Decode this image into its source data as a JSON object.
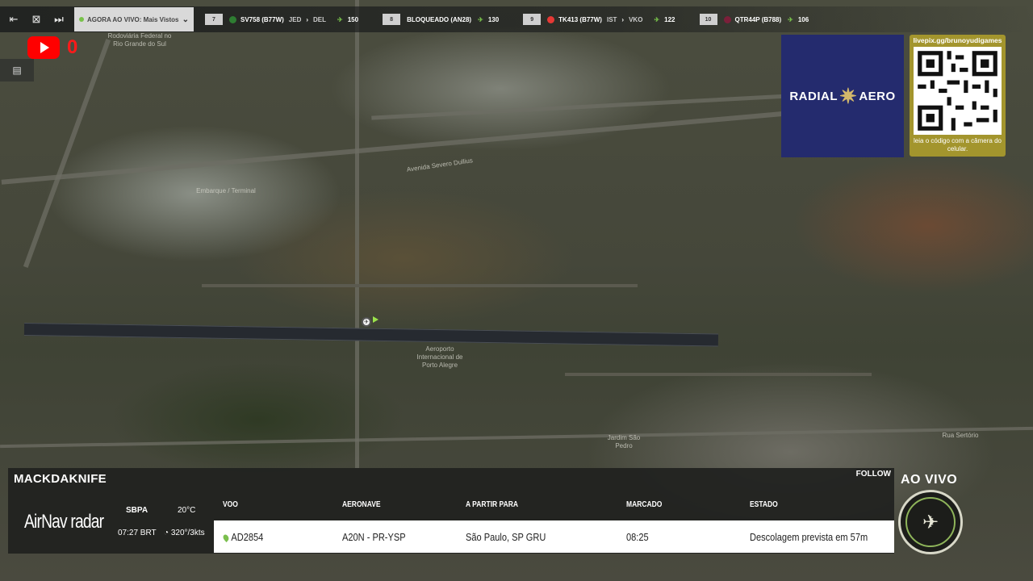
{
  "topbar": {
    "live_label": "AGORA AO VIVO: Mais Vistos",
    "flights": [
      {
        "rank": "7",
        "flag_color": "#2e7d32",
        "callsign": "SV758 (B77W)",
        "from": "JED",
        "to": "DEL",
        "count": "150"
      },
      {
        "rank": "8",
        "flag_color": "",
        "callsign": "BLOQUEADO (AN28)",
        "from": "",
        "to": "",
        "count": "130"
      },
      {
        "rank": "9",
        "flag_color": "#e53935",
        "callsign": "TK413 (B77W)",
        "from": "IST",
        "to": "VKO",
        "count": "122"
      },
      {
        "rank": "10",
        "flag_color": "#7b1f3a",
        "callsign": "QTR44P (B788)",
        "from": "",
        "to": "",
        "count": "106"
      }
    ]
  },
  "youtube": {
    "count": "0"
  },
  "map_labels": {
    "top": "Rodoviária Federal no Rio Grande do Sul",
    "airport": "Aeroporto Internacional de Porto Alegre",
    "terminal": "Embarque / Terminal",
    "avenue1": "Avenida Severo Dullius",
    "avenue2": "Rua Sertório",
    "jardim": "Jardim São Pedro"
  },
  "sponsor": {
    "left_text": "RADIAL",
    "right_text": "AERO",
    "url": "livepix.gg/brunoyudigames",
    "caption": "leia o código com a câmera do celular."
  },
  "panel": {
    "username": "MACKDAKNIFE",
    "follow": "FOLLOW",
    "brand": "AirNav",
    "brand2": "radar",
    "icao": "SBPA",
    "local_time": "07:27 BRT",
    "temp": "20°C",
    "wind": "320°/3kts",
    "headers": {
      "flight": "VOO",
      "aircraft": "AERONAVE",
      "route": "A PARTIR PARA",
      "scheduled": "MARCADO",
      "status": "ESTADO"
    },
    "row": {
      "flight": "AD2854",
      "aircraft": "A20N - PR-YSP",
      "route": "São Paulo, SP GRU",
      "scheduled": "08:25",
      "status": "Descolagem prevista em 57m"
    }
  },
  "live_badge": "AO VIVO"
}
